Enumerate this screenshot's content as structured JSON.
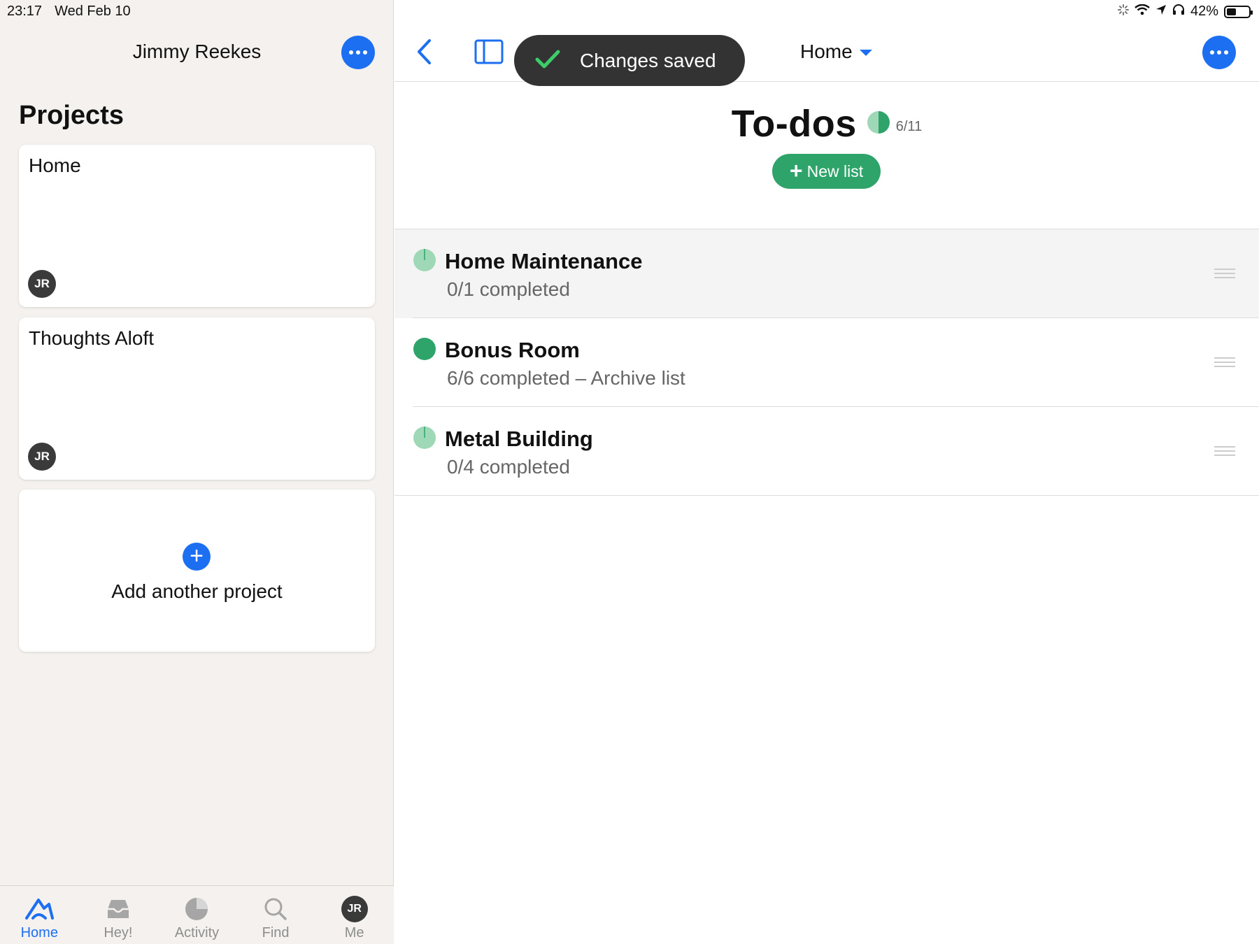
{
  "status": {
    "time": "23:17",
    "date": "Wed Feb 10",
    "battery": "42%"
  },
  "sidebar": {
    "user_name": "Jimmy Reekes",
    "projects_heading": "Projects",
    "projects": [
      {
        "title": "Home",
        "avatar": "JR"
      },
      {
        "title": "Thoughts Aloft",
        "avatar": "JR"
      }
    ],
    "add_project_label": "Add another project"
  },
  "tabs": [
    {
      "label": "Home",
      "icon": "home-icon",
      "active": true
    },
    {
      "label": "Hey!",
      "icon": "inbox-icon"
    },
    {
      "label": "Activity",
      "icon": "activity-icon"
    },
    {
      "label": "Find",
      "icon": "search-icon"
    },
    {
      "label": "Me",
      "icon": "avatar",
      "avatar": "JR"
    }
  ],
  "main": {
    "toast": "Changes saved",
    "project_switch": "Home",
    "title": "To-dos",
    "progress_label": "6/11",
    "new_list_label": "New list",
    "lists": [
      {
        "title": "Home Maintenance",
        "subtitle": "0/1 completed",
        "completed": 0,
        "total": 1
      },
      {
        "title": "Bonus Room",
        "subtitle": "6/6 completed – Archive list",
        "completed": 6,
        "total": 6
      },
      {
        "title": "Metal Building",
        "subtitle": "0/4 completed",
        "completed": 0,
        "total": 4
      }
    ]
  },
  "colors": {
    "accent": "#1d6ff2",
    "green": "#2ea46a",
    "light_green": "#9ed8b6"
  }
}
